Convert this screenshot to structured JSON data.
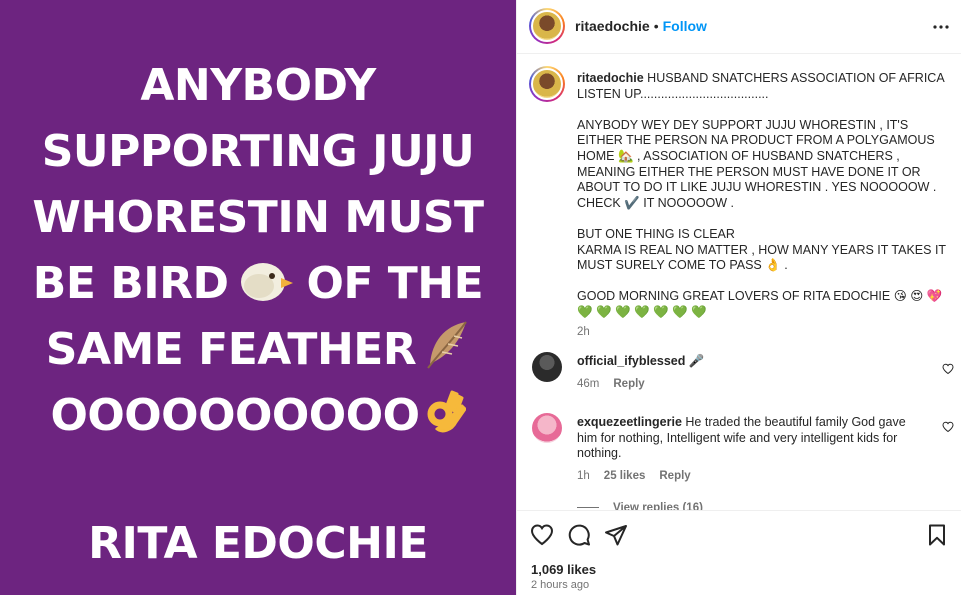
{
  "post_image": {
    "lines": [
      "ANYBODY",
      "SUPPORTING JUJU",
      "WHORESTIN MUST",
      "BE BIRD",
      "OF THE",
      "SAME FEATHER",
      "OOOOOOOOOO"
    ],
    "signature": "RITA EDOCHIE",
    "background_color": "#6d2480"
  },
  "header": {
    "username": "ritaedochie",
    "separator": "•",
    "follow_label": "Follow"
  },
  "caption": {
    "username": "ritaedochie",
    "text_1": "HUSBAND SNATCHERS ASSOCIATION OF AFRICA LISTEN UP.....................................",
    "text_2": "ANYBODY WEY DEY SUPPORT JUJU WHORESTIN , IT'S EITHER THE PERSON NA PRODUCT FROM A POLYGAMOUS HOME 🏡 , ASSOCIATION OF HUSBAND SNATCHERS , MEANING EITHER THE PERSON MUST HAVE DONE IT OR ABOUT TO DO IT LIKE JUJU WHORESTIN . YES NOOOOOW . CHECK ✔️ IT NOOOOOW .",
    "text_3": "BUT ONE THING IS CLEAR\nKARMA IS REAL NO MATTER , HOW MANY YEARS IT TAKES IT MUST SURELY COME TO PASS 👌 .",
    "text_4": "GOOD MORNING GREAT LOVERS OF RITA EDOCHIE 😘 😍 💖\n💚 💚 💚 💚 💚 💚 💚",
    "time": "2h"
  },
  "comments": [
    {
      "username": "official_ifyblessed",
      "text": "🎤",
      "time": "46m",
      "likes": "",
      "reply_label": "Reply"
    },
    {
      "username": "exquezeetlingerie",
      "text": "He traded the beautiful family God gave him for nothing, Intelligent wife and very intelligent kids for nothing.",
      "time": "1h",
      "likes": "25 likes",
      "reply_label": "Reply"
    }
  ],
  "view_replies_label": "View replies (16)",
  "actions": {
    "likes": "1,069 likes",
    "time_ago": "2 hours ago"
  },
  "icons": [
    "more-icon",
    "heart-icon",
    "comment-icon",
    "share-icon",
    "bookmark-icon",
    "chick-emoji",
    "feather-emoji",
    "ok-hand-emoji"
  ],
  "colors": {
    "follow": "#0095f6",
    "secondary_text": "#737373",
    "primary_text": "#262626"
  }
}
